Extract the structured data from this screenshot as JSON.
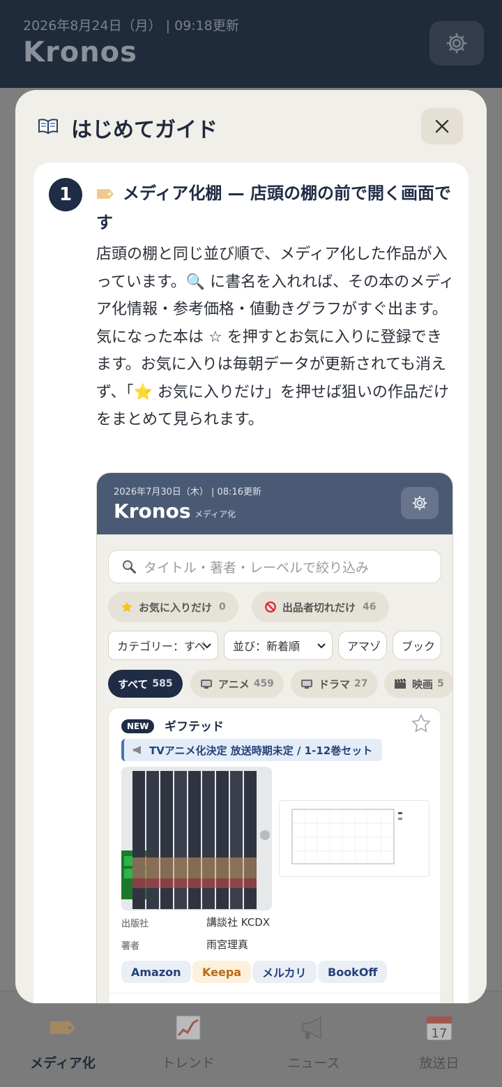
{
  "app": {
    "date": "2026年8月24日（月） | 09:18更新",
    "title": "Kronos"
  },
  "bottom_nav": [
    {
      "label": "メディア化",
      "icon": "tag-icon"
    },
    {
      "label": "トレンド",
      "icon": "trend-icon"
    },
    {
      "label": "ニュース",
      "icon": "megaphone-icon"
    },
    {
      "label": "放送日",
      "icon": "calendar-icon",
      "calendar_day": "17"
    }
  ],
  "modal": {
    "title": "はじめてガイド",
    "step": {
      "number": "1",
      "title": "メディア化棚 — 店頭の棚の前で開く画面です",
      "description": "店頭の棚と同じ並び順で、メディア化した作品が入っています。🔍 に書名を入れれば、その本のメディア化情報・参考価格・値動きグラフがすぐ出ます。気になった本は ☆ を押すとお気に入りに登録できます。お気に入りは毎朝データが更新されても消えず、「⭐ お気に入りだけ」を押せば狙いの作品だけをまとめて見られます。"
    }
  },
  "preview": {
    "date": "2026年7月30日（木） | 08:16更新",
    "title": "Kronos",
    "subtitle": "メディア化",
    "search_placeholder": "タイトル・著者・レーベルで絞り込み",
    "favorites_chip": {
      "label": "お気に入りだけ",
      "count": "0"
    },
    "soldout_chip": {
      "label": "出品者切れだけ",
      "count": "46"
    },
    "selects": [
      "カテゴリー：すべ",
      "並び：新着順",
      "アマゾ",
      "ブック"
    ],
    "categories": [
      {
        "label": "すべて",
        "count": "585"
      },
      {
        "label": "アニメ",
        "count": "459"
      },
      {
        "label": "ドラマ",
        "count": "27"
      },
      {
        "label": "映画",
        "count": "5"
      }
    ],
    "item": {
      "badge": "NEW",
      "title": "ギフテッド",
      "banner": "TVアニメ化決定 放送時期未定 / 1-12巻セット",
      "publisher_label": "出版社",
      "publisher": "講談社 KCDX",
      "author_label": "著者",
      "author": "雨宮理真",
      "links": [
        "Amazon",
        "Keepa",
        "メルカリ",
        "BookOff"
      ]
    }
  }
}
